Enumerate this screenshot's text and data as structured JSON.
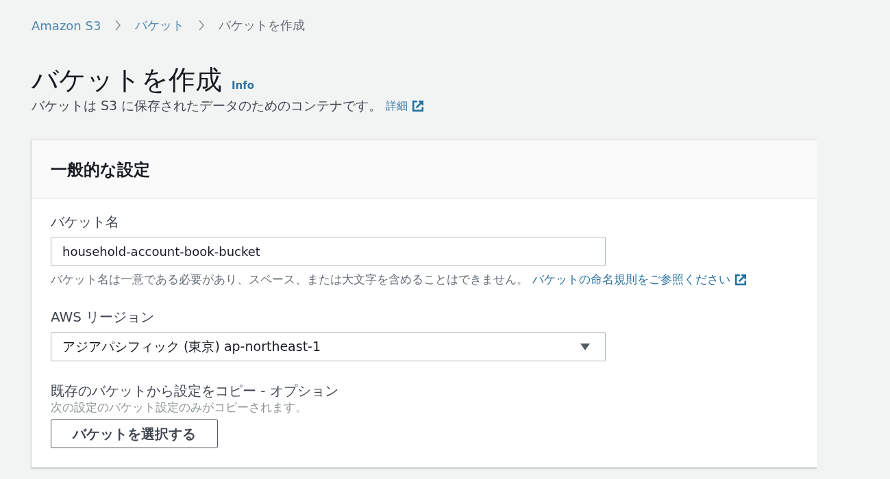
{
  "breadcrumb": [
    {
      "label": "Amazon S3",
      "kind": "link"
    },
    {
      "label": "バケット",
      "kind": "link"
    },
    {
      "label": "バケットを作成",
      "kind": "current"
    }
  ],
  "header": {
    "title": "バケットを作成",
    "info_link": "Info",
    "description": "バケットは S3 に保存されたデータのためのコンテナです。",
    "description_link": "詳細"
  },
  "panel": {
    "title": "一般的な設定",
    "fields": [
      {
        "kind": "text",
        "label": "バケット名",
        "value": "household-account-book-bucket",
        "hint": "バケット名は一意である必要があり、スペース、または大文字を含めることはできません。",
        "hint_link": "バケットの命名規則をご参照ください"
      },
      {
        "kind": "select",
        "label": "AWS リージョン",
        "value": "アジアパシフィック (東京) ap-northeast-1"
      },
      {
        "kind": "button",
        "label": "既存のバケットから設定をコピー - オプション",
        "hint": "次の設定のバケット設定のみがコピーされます。",
        "button": "バケットを選択する"
      }
    ]
  }
}
